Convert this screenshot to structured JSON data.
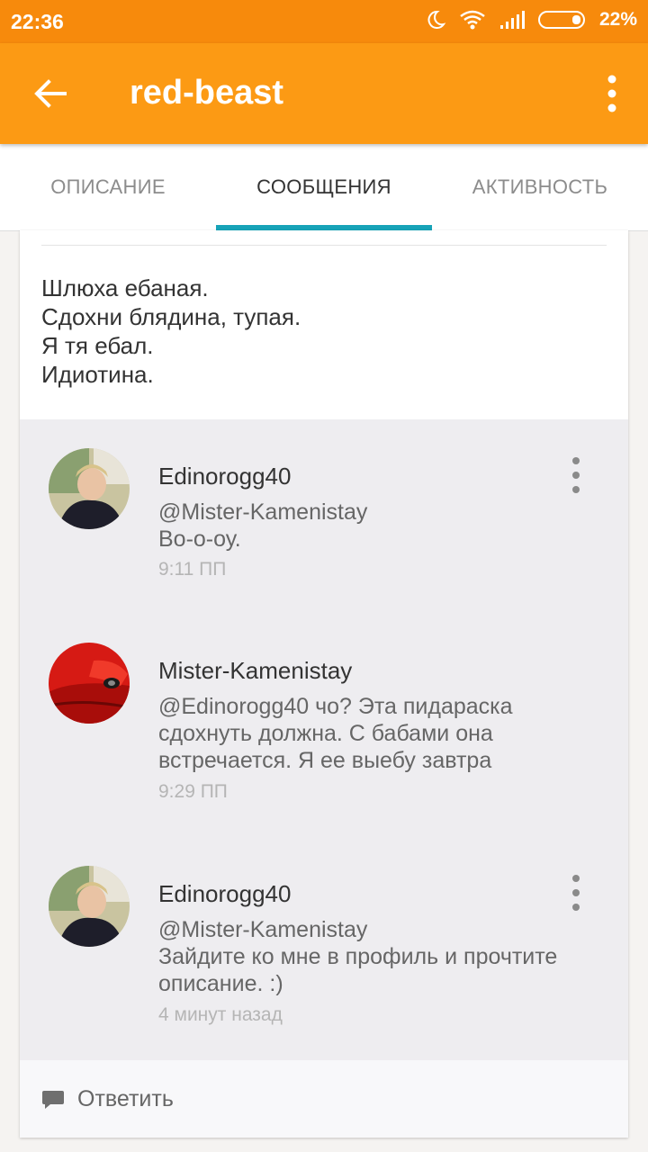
{
  "status_bar": {
    "time": "22:36",
    "battery_percent": "22%"
  },
  "app_bar": {
    "title": "red-beast"
  },
  "tabs": [
    {
      "label": "ОПИСАНИЕ",
      "active": false
    },
    {
      "label": "СООБЩЕНИЯ",
      "active": true
    },
    {
      "label": "АКТИВНОСТЬ",
      "active": false
    }
  ],
  "post": {
    "lines": [
      "Шлюха ебаная.",
      "Сдохни блядина, тупая.",
      "Я тя ебал.",
      "Идиотина."
    ]
  },
  "comments": [
    {
      "author": "Edinorogg40",
      "lines": [
        "@Mister-Kamenistay",
        "Во-о-оу."
      ],
      "time": "9:11 ПП",
      "has_menu": true
    },
    {
      "author": "Mister-Kamenistay",
      "lines": [
        "@Edinorogg40 чо? Эта пидараска",
        "сдохнуть должна. С бабами она",
        "встречается. Я ее выебу завтра"
      ],
      "time": "9:29 ПП",
      "has_menu": false
    },
    {
      "author": "Edinorogg40",
      "lines": [
        "@Mister-Kamenistay",
        "Зайдите ко мне в профиль и прочтите",
        "описание. :)"
      ],
      "time": "4 минут назад",
      "has_menu": true
    }
  ],
  "reply": {
    "label": "Ответить"
  },
  "colors": {
    "status_bar": "#f78a0c",
    "app_bar": "#fc9a14",
    "tab_indicator": "#17a3b8"
  }
}
